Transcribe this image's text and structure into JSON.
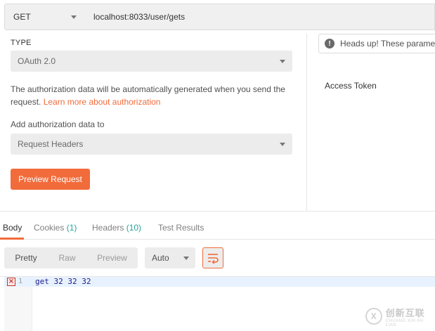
{
  "request": {
    "method": "GET",
    "url": "localhost:8033/user/gets"
  },
  "auth": {
    "type_label": "TYPE",
    "type_value": "OAuth 2.0",
    "description": "The authorization data will be automatically generated when you send the request. ",
    "learn_more_link": "Learn more about authorization",
    "add_to_label": "Add authorization data to",
    "add_to_value": "Request Headers",
    "preview_button": "Preview Request"
  },
  "right_panel": {
    "headsup_text": "Heads up! These parameters",
    "access_token_label": "Access Token"
  },
  "response_tabs": [
    {
      "label": "Body",
      "count": ""
    },
    {
      "label": "Cookies",
      "count": "(1)"
    },
    {
      "label": "Headers",
      "count": "(10)"
    },
    {
      "label": "Test Results",
      "count": ""
    }
  ],
  "response_toolbar": {
    "views": [
      "Pretty",
      "Raw",
      "Preview"
    ],
    "format": "Auto"
  },
  "editor": {
    "line_number": "1",
    "code": "get 32 32 32"
  },
  "watermark": {
    "main": "创新互联",
    "sub": "CHUANG XIN HU LIAN"
  },
  "colors": {
    "accent": "#f26b3a",
    "count": "#26a69a"
  }
}
